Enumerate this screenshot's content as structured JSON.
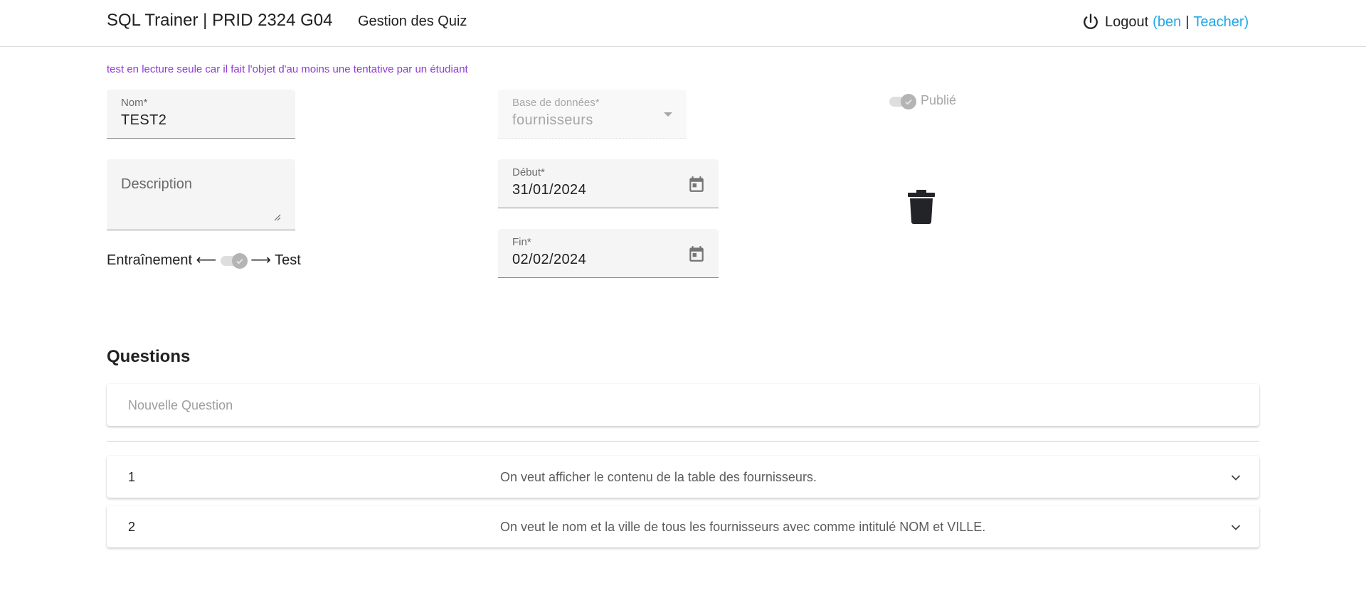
{
  "header": {
    "title": "SQL Trainer | PRID 2324 G04",
    "nav_link": "Gestion des Quiz",
    "logout_label": "Logout",
    "user": "(ben",
    "separator": "|",
    "role": "Teacher)"
  },
  "warning": "test en lecture seule car il fait l'objet d'au moins une tentative par un étudiant",
  "form": {
    "name_label": "Nom*",
    "name_value": "TEST2",
    "database_label": "Base de données*",
    "database_value": "fournisseurs",
    "published_label": "Publié",
    "description_placeholder": "Description",
    "start_label": "Début*",
    "start_value": "31/01/2024",
    "end_label": "Fin*",
    "end_value": "02/02/2024",
    "mode_left": "Entraînement ⟵",
    "mode_right": "⟶ Test"
  },
  "questions": {
    "title": "Questions",
    "new_placeholder": "Nouvelle Question",
    "items": [
      {
        "number": "1",
        "text": "On veut afficher le contenu de la table des fournisseurs."
      },
      {
        "number": "2",
        "text": "On veut le nom et la ville de tous les fournisseurs avec comme intitulé NOM et VILLE."
      }
    ]
  },
  "colors": {
    "accent": "#1ea7e8",
    "warning": "#8f3ad6"
  }
}
